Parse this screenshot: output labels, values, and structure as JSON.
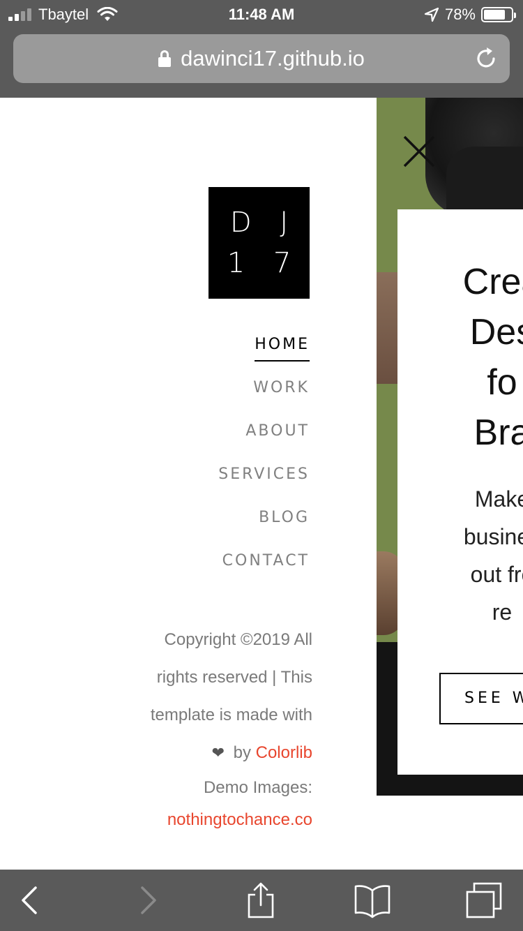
{
  "status_bar": {
    "carrier": "Tbaytel",
    "time": "11:48 AM",
    "battery_percent": "78%",
    "battery_level": 0.78,
    "signal_bars_active": 2,
    "signal_bars_total": 4
  },
  "browser": {
    "url": "dawinci17.github.io",
    "secure": true
  },
  "sidebar": {
    "logo_line1": "D J",
    "logo_line2": "1 7",
    "nav": [
      {
        "label": "HOME",
        "active": true
      },
      {
        "label": "WORK",
        "active": false
      },
      {
        "label": "ABOUT",
        "active": false
      },
      {
        "label": "SERVICES",
        "active": false
      },
      {
        "label": "BLOG",
        "active": false
      },
      {
        "label": "CONTACT",
        "active": false
      }
    ],
    "footer": {
      "line1": "Copyright ©2019 All",
      "line2": "rights reserved | This",
      "line3": "template is made with",
      "by_text": "by",
      "colorlib": "Colorlib",
      "demo_label": "Demo Images:",
      "demo_link": "nothingtochance.co"
    }
  },
  "hero": {
    "title_lines": [
      "Crea",
      "Des",
      "fo",
      "Bra"
    ],
    "text_lines": [
      "Make",
      "busines",
      "out fro",
      "re"
    ],
    "button_label": "SEE W"
  },
  "colors": {
    "chrome": "#5a5a5a",
    "url_pill": "#9a9a9a",
    "hero_green": "#76894b",
    "link_red": "#e8462e",
    "nav_inactive": "#808080"
  },
  "icons": {
    "wifi": "wifi-icon",
    "location": "location-arrow-icon",
    "lock": "lock-icon",
    "reload": "reload-icon",
    "close": "close-icon",
    "heart": "heart-icon",
    "back": "chevron-left-icon",
    "forward": "chevron-right-icon",
    "share": "share-icon",
    "bookmarks": "bookmarks-icon",
    "tabs": "tabs-icon"
  }
}
